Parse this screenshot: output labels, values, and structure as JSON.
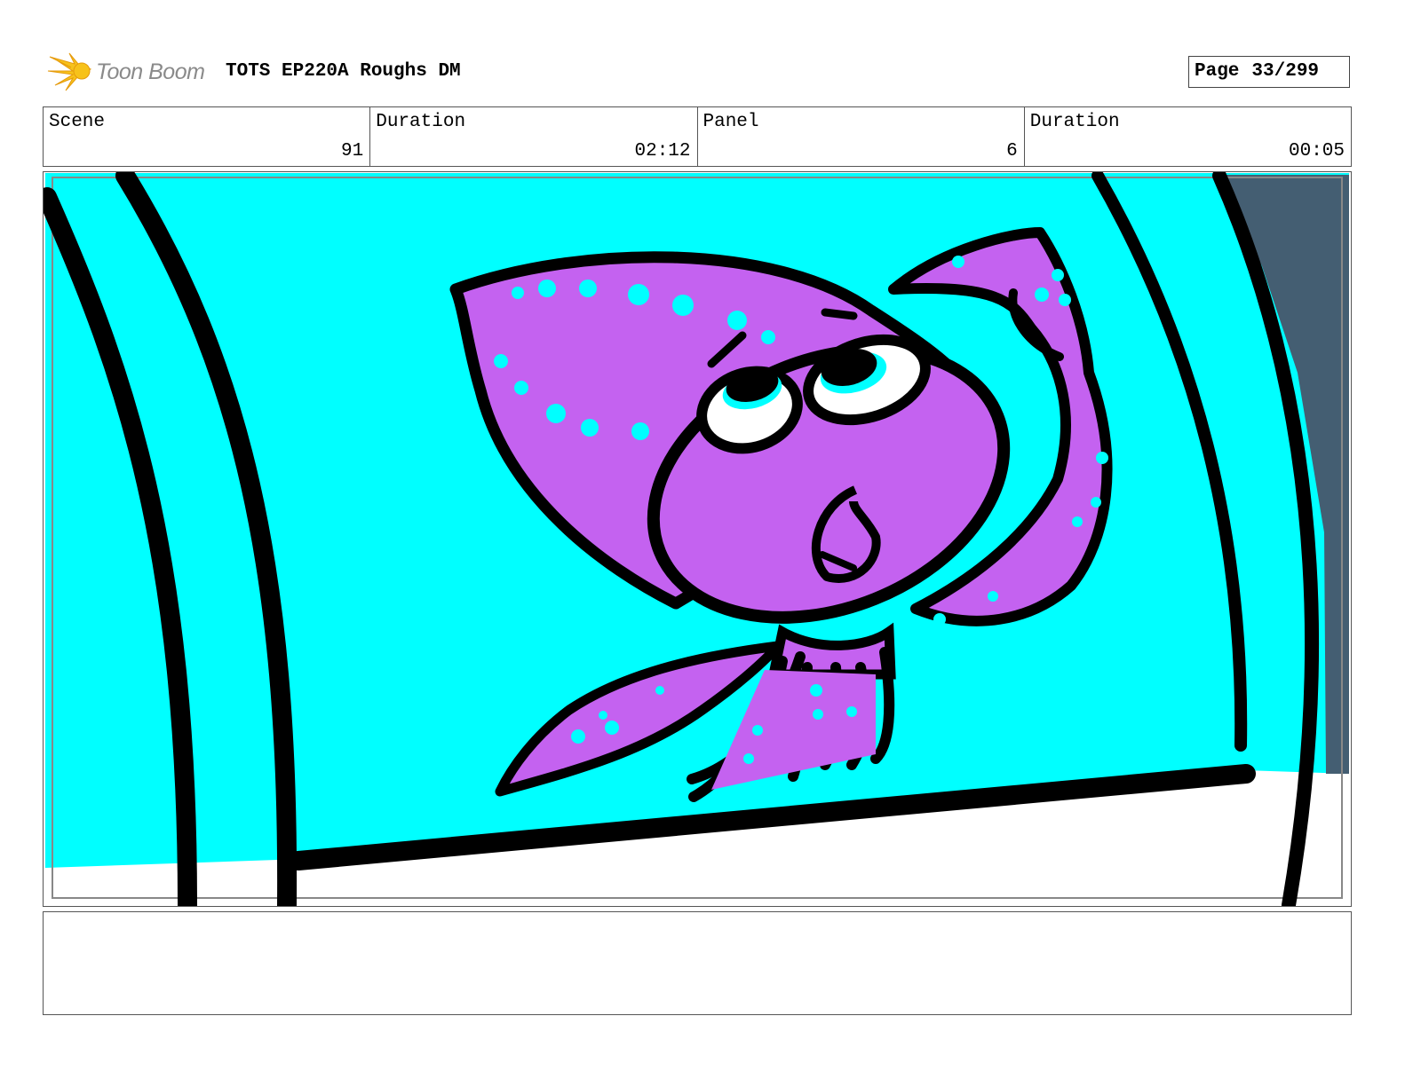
{
  "header": {
    "logo_text": "Toon Boom",
    "project_title": "TOTS EP220A Roughs DM",
    "page_label": "Page",
    "page_number": "33/299"
  },
  "info": [
    {
      "label": "Scene",
      "value": "91"
    },
    {
      "label": "Duration",
      "value": "02:12"
    },
    {
      "label": "Panel",
      "value": "6"
    },
    {
      "label": "Duration",
      "value": "00:05"
    }
  ],
  "notes": {
    "text": ""
  },
  "colors": {
    "water": "#00FFFF",
    "squid": "#C462F0",
    "outline": "#000000",
    "shadow": "#445E72",
    "logo_star": "#F7C21A"
  }
}
